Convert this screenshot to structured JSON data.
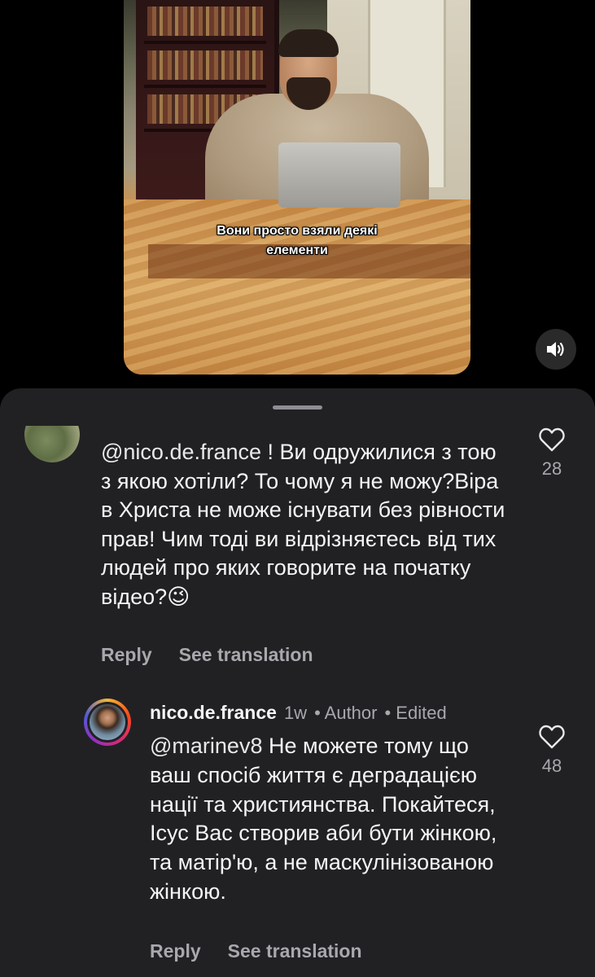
{
  "video": {
    "caption_lines": [
      "Вони просто взяли деякі",
      "елементи"
    ],
    "sound_icon": "speaker-icon"
  },
  "comments": [
    {
      "mention": "@nico.de.france",
      "text": " ! Ви одружилися з тою з якою хотіли? То чому я не можу?Віра в Христа не може існувати без рівности прав! Чим тоді ви відрізняєтесь від тих людей про яких говорите на початку відео?😉",
      "likes": "28",
      "reply_label": "Reply",
      "translate_label": "See translation"
    },
    {
      "username": "nico.de.france",
      "time": "1w",
      "author_tag": "• Author",
      "edited_tag": "• Edited",
      "mention": "@marinev8",
      "text": " Не можете тому що ваш спосіб життя є деградацією нації та християнства.  Покайтеся, Ісус Вас створив аби бути жінкою, та матір'ю, а не маскулінізованою жінкою.",
      "likes": "48",
      "reply_label": "Reply",
      "translate_label": "See translation"
    }
  ],
  "colors": {
    "sheet_bg": "#212124",
    "secondary_text": "#a8a8ad",
    "primary_text": "#f4f4f4"
  }
}
